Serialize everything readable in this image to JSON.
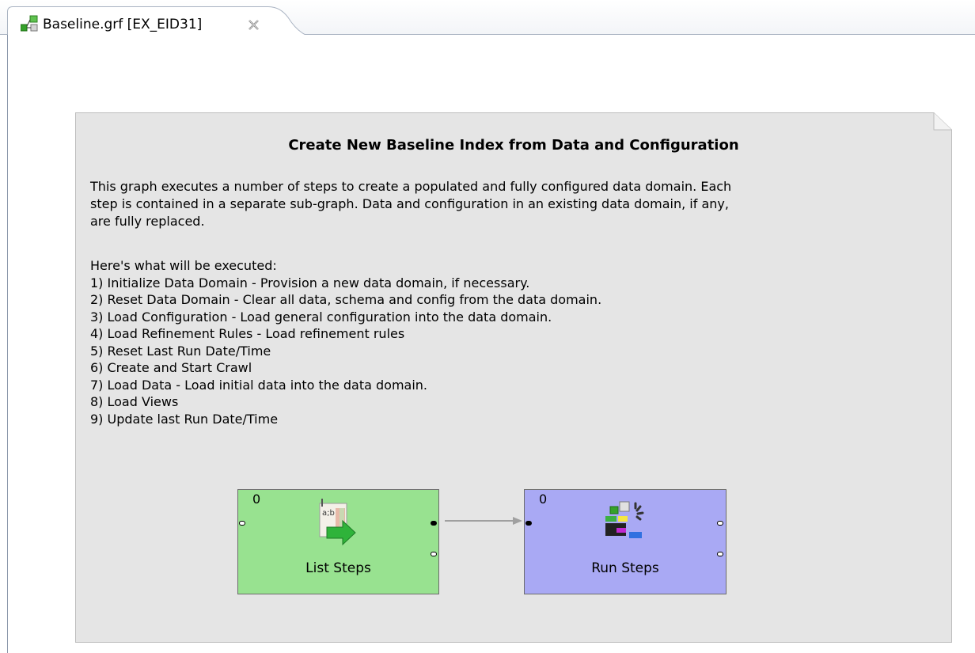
{
  "tab": {
    "title": "Baseline.grf [EX_EID31]",
    "icon": "graph-file-icon",
    "close_icon": "close-icon"
  },
  "note": {
    "title": "Create New Baseline Index from Data and Configuration",
    "description_lines": [
      "This graph executes a number of steps to create a populated and fully configured data domain. Each",
      "step is contained in a separate sub-graph. Data and configuration in an existing data domain, if any,",
      "are fully replaced."
    ],
    "list_intro": "Here's what will be executed:",
    "steps": [
      "1) Initialize Data Domain - Provision a new data domain, if necessary.",
      "2) Reset Data Domain - Clear all data, schema and config from the data domain.",
      "3) Load Configuration - Load general configuration into the data domain.",
      "4) Load Refinement Rules - Load refinement rules",
      "5) Reset Last Run Date/Time",
      "6) Create and Start Crawl",
      "7) Load Data - Load initial data into the data domain.",
      "8) Load Views",
      "9) Update last Run Date/Time"
    ]
  },
  "nodes": {
    "list_steps": {
      "count": "0",
      "label": "List Steps",
      "color": "#98e290",
      "icon": "list-steps-icon"
    },
    "run_steps": {
      "count": "0",
      "label": "Run Steps",
      "color": "#a9a9f4",
      "icon": "run-steps-icon"
    }
  },
  "colors": {
    "note_bg": "#e5e5e5",
    "note_border": "#bdbdbd",
    "edge": "#a0a0a0"
  }
}
